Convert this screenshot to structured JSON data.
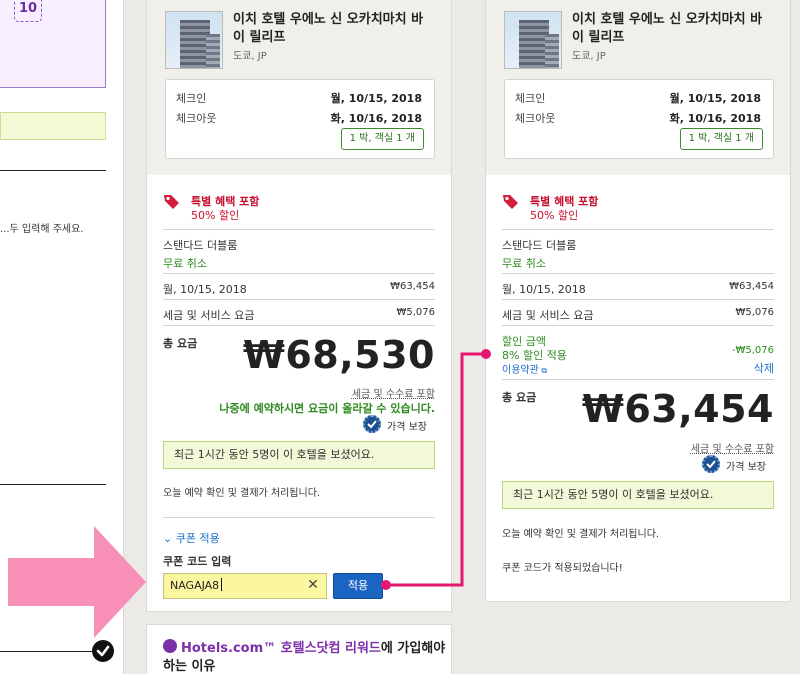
{
  "left_panel": {
    "calendar_badge": "10",
    "note": "...두 입력해 주세요."
  },
  "hotel": {
    "name": "이치 호텔 우에노 신 오카치마치 바이 릴리프",
    "location": "도쿄, JP",
    "checkin_label": "체크인",
    "checkin_date": "월, 10/15, 2018",
    "checkout_label": "체크아웃",
    "checkout_date": "화, 10/16, 2018",
    "nights_rooms": "1 박, 객실 1 개"
  },
  "deal": {
    "title": "특별 혜택 포함",
    "discount": "50% 할인"
  },
  "room": {
    "type": "스탠다드 더블룸",
    "cancel": "무료 취소",
    "night_date": "월, 10/15, 2018",
    "night_price": "₩63,454",
    "tax_label": "세금 및 서비스 요금",
    "tax_price": "₩5,076"
  },
  "before": {
    "total_label": "총 요금",
    "total": "₩68,530",
    "fee_note": "세금 및 수수료 포함",
    "price_warning": "나중에 예약하시면 요금이 올라갈 수 있습니다.",
    "guarantee": "가격 보장",
    "recent_views": "최근 1시간 동안 5명이 이 호텔을 보셨어요.",
    "confirm_note": "오늘 예약 확인 및 결제가 처리됩니다.",
    "coupon_toggle": "쿠폰 적용",
    "coupon_label": "쿠폰 코드 입력",
    "coupon_value": "NAGAJA8",
    "clear": "✕",
    "apply": "적용"
  },
  "after": {
    "discount_label": "할인 금액",
    "discount_desc": "8% 할인 적용",
    "discount_amount": "-₩5,076",
    "terms_link": "이용약관",
    "remove": "삭제",
    "total_label": "총 요금",
    "total": "₩63,454",
    "fee_note": "세금 및 수수료 포함",
    "guarantee": "가격 보장",
    "recent_views": "최근 1시간 동안 5명이 이 호텔을 보셨어요.",
    "confirm_note": "오늘 예약 확인 및 결제가 처리됩니다.",
    "coupon_applied": "쿠폰 코드가 적용되었습니다!"
  },
  "rewards": {
    "brand": "Hotels.com™ 호텔스닷컴 리워드",
    "title_rest": "에 가입해야",
    "title_line2": "하는 이유"
  },
  "colors": {
    "accent_pink": "#e5176e",
    "arrow_pink": "#f78fb6",
    "red": "#c8102e",
    "green": "#2e8b1f",
    "blue_button": "#1b65c2"
  }
}
